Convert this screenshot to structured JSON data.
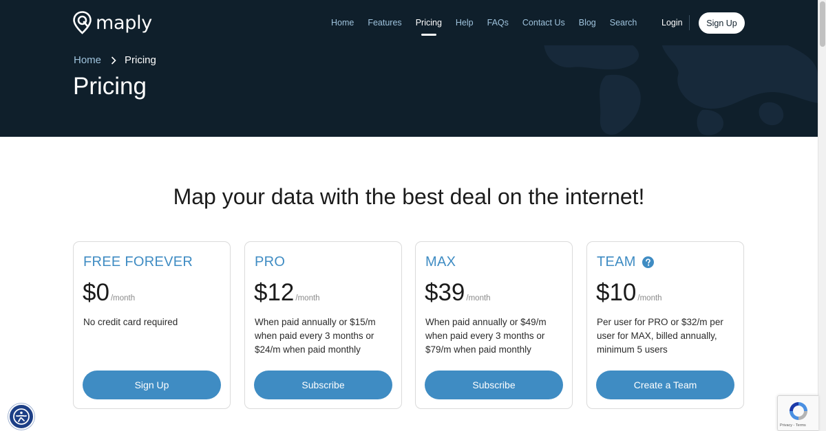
{
  "brand": {
    "name": "maply"
  },
  "nav": {
    "items": [
      {
        "label": "Home"
      },
      {
        "label": "Features"
      },
      {
        "label": "Pricing",
        "active": true
      },
      {
        "label": "Help"
      },
      {
        "label": "FAQs"
      },
      {
        "label": "Contact Us"
      },
      {
        "label": "Blog"
      },
      {
        "label": "Search"
      }
    ],
    "login_label": "Login",
    "signup_label": "Sign Up"
  },
  "breadcrumb": {
    "home": "Home",
    "current": "Pricing"
  },
  "page_title": "Pricing",
  "headline": "Map your data with the best deal on the internet!",
  "plans": [
    {
      "name": "FREE FOREVER",
      "price": "$0",
      "period": "/month",
      "description": "No credit card required",
      "button": "Sign Up"
    },
    {
      "name": "PRO",
      "price": "$12",
      "period": "/month",
      "description": "When paid annually or $15/m when paid every 3 months or $24/m when paid monthly",
      "button": "Subscribe"
    },
    {
      "name": "MAX",
      "price": "$39",
      "period": "/month",
      "description": "When paid annually or $49/m when paid every 3 months or $79/m when paid monthly",
      "button": "Subscribe"
    },
    {
      "name": "TEAM",
      "price": "$10",
      "period": "/month",
      "description": "Per user for PRO or $32/m per user for MAX, billed annually, minimum 5 users",
      "button": "Create a Team",
      "has_help_icon": true
    }
  ],
  "recaptcha": {
    "links": "Privacy - Terms"
  },
  "icons": {
    "logo": "map-pin-icon",
    "breadcrumb_separator": "chevron-right-icon",
    "team_help": "question-circle-icon",
    "accessibility": "accessibility-icon",
    "recaptcha": "recaptcha-icon"
  },
  "colors": {
    "header_bg": "#0f1f2b",
    "accent": "#3f8cc3",
    "nav_link": "#9fc3dd",
    "text": "#1b1b1b"
  }
}
